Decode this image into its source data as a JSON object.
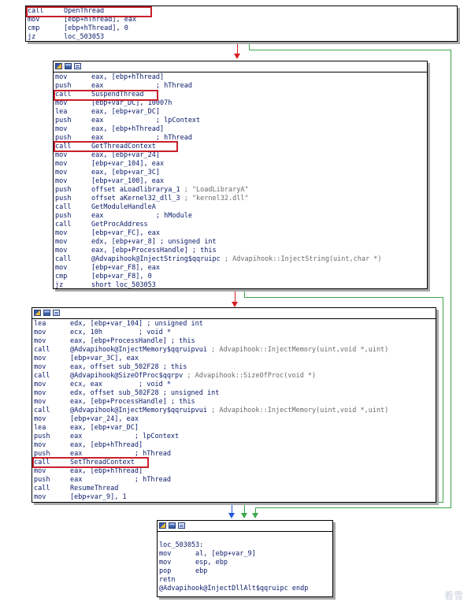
{
  "blocks": [
    {
      "lines": [
        {
          "op": "call",
          "arg": "OpenThread"
        },
        {
          "op": "mov",
          "arg": "[ebp+hThread], eax"
        },
        {
          "op": "cmp",
          "arg": "[ebp+hThread], 0"
        },
        {
          "op": "jz",
          "arg": "loc_503053"
        }
      ]
    },
    {
      "lines": [
        {
          "op": "mov",
          "arg": "eax, [ebp+hThread]"
        },
        {
          "op": "push",
          "arg": "eax             ; hThread"
        },
        {
          "op": "call",
          "arg": "SuspendThread"
        },
        {
          "op": "mov",
          "arg": "[ebp+var_DC], 10007h"
        },
        {
          "op": "lea",
          "arg": "eax, [ebp+var_DC]"
        },
        {
          "op": "push",
          "arg": "eax             ; lpContext"
        },
        {
          "op": "mov",
          "arg": "eax, [ebp+hThread]"
        },
        {
          "op": "push",
          "arg": "eax             ; hThread"
        },
        {
          "op": "call",
          "arg": "GetThreadContext"
        },
        {
          "op": "mov",
          "arg": "eax, [ebp+var_24]"
        },
        {
          "op": "mov",
          "arg": "[ebp+var_104], eax"
        },
        {
          "op": "mov",
          "arg": "eax, [ebp+var_3C]"
        },
        {
          "op": "mov",
          "arg": "[ebp+var_100], eax"
        },
        {
          "op": "push",
          "arg": "offset aLoadlibrarya_1 ",
          "cmt": "; \"LoadLibraryA\""
        },
        {
          "op": "push",
          "arg": "offset aKernel32_dll_3 ",
          "cmt": "; \"kernel32.dll\""
        },
        {
          "op": "call",
          "arg": "GetModuleHandleA"
        },
        {
          "op": "push",
          "arg": "eax             ; hModule"
        },
        {
          "op": "call",
          "arg": "GetProcAddress"
        },
        {
          "op": "mov",
          "arg": "[ebp+var_FC], eax"
        },
        {
          "op": "mov",
          "arg": "edx, [ebp+var_8] ; unsigned int"
        },
        {
          "op": "mov",
          "arg": "eax, [ebp+ProcessHandle] ; this"
        },
        {
          "op": "call",
          "arg": "@Advapihook@InjectString$qqruipc ",
          "cmt": "; Advapihook::InjectString(uint,char *)"
        },
        {
          "op": "mov",
          "arg": "[ebp+var_F8], eax"
        },
        {
          "op": "cmp",
          "arg": "[ebp+var_F8], 0"
        },
        {
          "op": "jz",
          "arg": "short loc_503053"
        }
      ]
    },
    {
      "lines": [
        {
          "op": "lea",
          "arg": "edx, [ebp+var_104] ; unsigned int"
        },
        {
          "op": "mov",
          "arg": "ecx, 10h         ; void *"
        },
        {
          "op": "mov",
          "arg": "eax, [ebp+ProcessHandle] ; this"
        },
        {
          "op": "call",
          "arg": "@Advapihook@InjectMemory$qqruipvui ",
          "cmt": "; Advapihook::InjectMemory(uint,void *,uint)"
        },
        {
          "op": "mov",
          "arg": "[ebp+var_3C], eax"
        },
        {
          "op": "mov",
          "arg": "eax, offset sub_502F28 ; this"
        },
        {
          "op": "call",
          "arg": "@Advapihook@SizeOfProc$qqrpv ",
          "cmt": "; Advapihook::SizeOfProc(void *)"
        },
        {
          "op": "mov",
          "arg": "ecx, eax         ; void *"
        },
        {
          "op": "mov",
          "arg": "edx, offset sub_502F28 ; unsigned int"
        },
        {
          "op": "mov",
          "arg": "eax, [ebp+ProcessHandle] ; this"
        },
        {
          "op": "call",
          "arg": "@Advapihook@InjectMemory$qqruipvui ",
          "cmt": "; Advapihook::InjectMemory(uint,void *,uint)"
        },
        {
          "op": "mov",
          "arg": "[ebp+var_24], eax"
        },
        {
          "op": "lea",
          "arg": "eax, [ebp+var_DC]"
        },
        {
          "op": "push",
          "arg": "eax             ; lpContext"
        },
        {
          "op": "mov",
          "arg": "eax, [ebp+hThread]"
        },
        {
          "op": "push",
          "arg": "eax             ; hThread"
        },
        {
          "op": "call",
          "arg": "SetThreadContext"
        },
        {
          "op": "mov",
          "arg": "eax, [ebp+hThread]"
        },
        {
          "op": "push",
          "arg": "eax             ; hThread"
        },
        {
          "op": "call",
          "arg": "ResumeThread"
        },
        {
          "op": "mov",
          "arg": "[ebp+var_9], 1"
        }
      ]
    },
    {
      "lines": [
        {
          "op": "",
          "arg": ""
        },
        {
          "op": "loc_503053:",
          "arg": ""
        },
        {
          "op": "mov",
          "arg": "al, [ebp+var_9]"
        },
        {
          "op": "mov",
          "arg": "esp, ebp"
        },
        {
          "op": "pop",
          "arg": "ebp"
        },
        {
          "op": "retn",
          "arg": ""
        },
        {
          "op": "@Advapihook@InjectDllAlt$qqruipc endp",
          "arg": ""
        }
      ]
    }
  ],
  "colors": {
    "text": "#0a1a6a",
    "comment": "#6b6b6b",
    "highlight": "#c8202a",
    "edge_false": "#d42020",
    "edge_true": "#3ca84a",
    "edge_unconditional": "#1f56e0"
  },
  "titlebar_icons": [
    "graph-icon",
    "image-icon",
    "listing-icon"
  ],
  "watermark": "看雪"
}
